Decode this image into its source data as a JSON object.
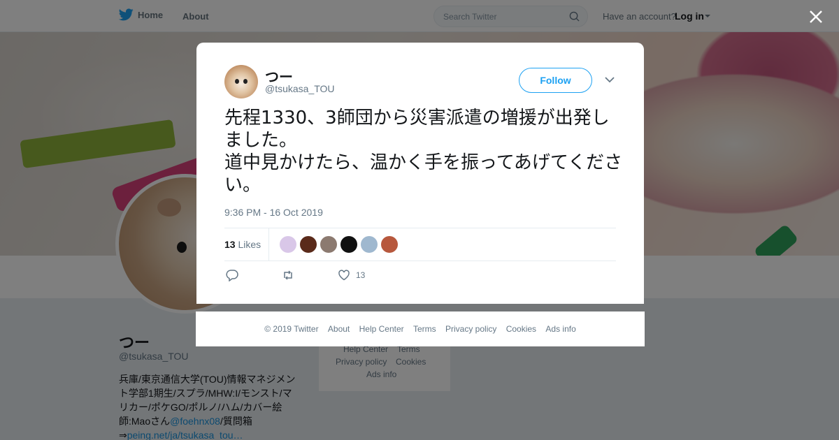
{
  "topbar": {
    "home_label": "Home",
    "about_label": "About",
    "search_placeholder": "Search Twitter",
    "have_account": "Have an account?",
    "login_label": "Log in"
  },
  "profile": {
    "name": "つー",
    "handle": "@tsukasa_TOU",
    "bio_before_link": "兵庫/東京通信大学(TOU)情報マネジメント学部1期生/スプラ/MHW:I/モンスト/マリカー/ポケGO/ポルノ/ハム/カバー絵師:Maoさん",
    "bio_mention": "@foehnx08",
    "bio_after_mention": "/質問箱⇒",
    "bio_url": "peing.net/ja/tsukasa_tou…"
  },
  "background_footer": {
    "help_center": "Help Center",
    "terms": "Terms",
    "privacy": "Privacy policy",
    "cookies": "Cookies",
    "ads_info": "Ads info"
  },
  "tweet": {
    "author_name": "つー",
    "author_handle": "@tsukasa_TOU",
    "follow_label": "Follow",
    "text": "先程1330、3師団から災害派遣の増援が出発しました。\n道中見かけたら、温かく手を振ってあげてください。",
    "timestamp": "9:36 PM - 16 Oct 2019",
    "likes_count": "13",
    "likes_label": "Likes",
    "like_action_count": "13",
    "liker_colors": [
      "#d9c7e8",
      "#5a2a1a",
      "#8c7a70",
      "#101010",
      "#9fb8cf",
      "#b7583d"
    ]
  },
  "modal_footer": {
    "copyright": "© 2019 Twitter",
    "about": "About",
    "help_center": "Help Center",
    "terms": "Terms",
    "privacy": "Privacy policy",
    "cookies": "Cookies",
    "ads_info": "Ads info"
  },
  "colors": {
    "brand": "#1da1f2",
    "text_primary": "#14171a",
    "text_secondary": "#657786"
  }
}
